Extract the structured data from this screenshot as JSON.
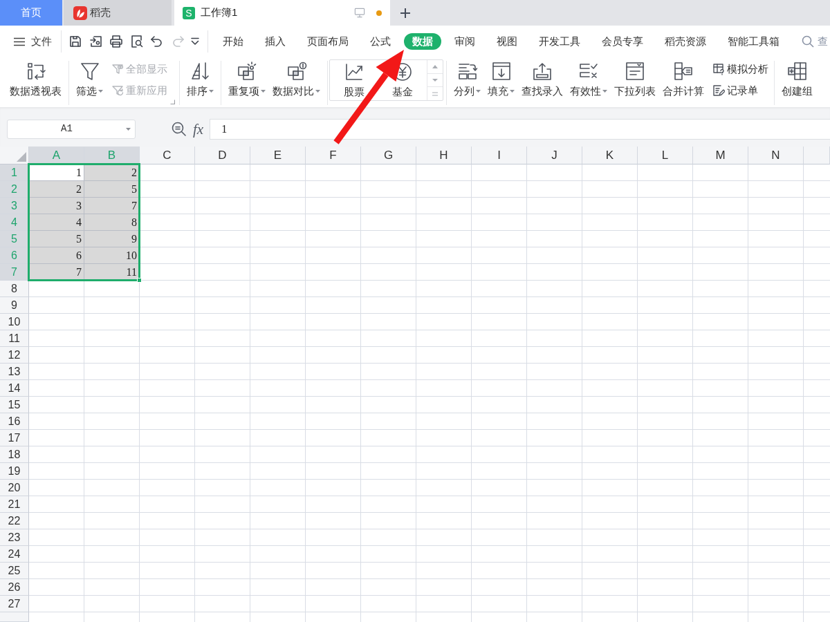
{
  "tabs": [
    {
      "kind": "home",
      "label": "首页",
      "selected": false
    },
    {
      "kind": "docer",
      "label": "稻壳",
      "selected": false
    },
    {
      "kind": "sheet",
      "badge": "S",
      "label": "工作簿1",
      "selected": true,
      "modified": true
    }
  ],
  "menu_bar": {
    "file_label": "文件",
    "quick_access": [
      {
        "kind": "save",
        "disabled": false
      },
      {
        "kind": "export",
        "disabled": false
      },
      {
        "kind": "print",
        "disabled": false
      },
      {
        "kind": "preview",
        "disabled": false
      },
      {
        "kind": "undo",
        "disabled": false
      },
      {
        "kind": "redo",
        "disabled": true
      },
      {
        "kind": "customize",
        "disabled": false
      }
    ],
    "tabs": [
      {
        "label": "开始",
        "selected": false
      },
      {
        "label": "插入",
        "selected": false
      },
      {
        "label": "页面布局",
        "selected": false
      },
      {
        "label": "公式",
        "selected": false
      },
      {
        "label": "数据",
        "selected": true
      },
      {
        "label": "审阅",
        "selected": false
      },
      {
        "label": "视图",
        "selected": false
      },
      {
        "label": "开发工具",
        "selected": false
      },
      {
        "label": "会员专享",
        "selected": false
      },
      {
        "label": "稻壳资源",
        "selected": false
      },
      {
        "label": "智能工具箱",
        "selected": false
      }
    ],
    "search_label": "查"
  },
  "ribbon": {
    "groups": [
      {
        "large": [
          {
            "kind": "pivot",
            "label": "数据透视表",
            "dropdown": false
          }
        ]
      },
      {
        "large": [
          {
            "kind": "filter",
            "label": "筛选",
            "dropdown": true
          }
        ],
        "small": [
          {
            "kind": "showall",
            "label": "全部显示",
            "disabled": true
          },
          {
            "kind": "reapply",
            "label": "重新应用",
            "disabled": true
          }
        ],
        "launcher": true
      },
      {
        "large": [
          {
            "kind": "sort",
            "label": "排序",
            "dropdown": true
          }
        ]
      },
      {
        "large": [
          {
            "kind": "duplicates",
            "label": "重复项",
            "dropdown": true
          },
          {
            "kind": "compare",
            "label": "数据对比",
            "dropdown": true
          }
        ]
      },
      {
        "gallery": [
          {
            "kind": "stock",
            "label": "股票"
          },
          {
            "kind": "fund",
            "label": "基金"
          }
        ]
      },
      {
        "large": [
          {
            "kind": "split",
            "label": "分列",
            "dropdown": true
          },
          {
            "kind": "fill",
            "label": "填充",
            "dropdown": true
          },
          {
            "kind": "lookup",
            "label": "查找录入",
            "dropdown": false
          },
          {
            "kind": "validity",
            "label": "有效性",
            "dropdown": true
          },
          {
            "kind": "dropdown",
            "label": "下拉列表",
            "dropdown": false
          },
          {
            "kind": "consolidate",
            "label": "合并计算",
            "dropdown": false
          }
        ],
        "small": [
          {
            "kind": "whatif",
            "label": "模拟分析",
            "disabled": false
          },
          {
            "kind": "form",
            "label": "记录单",
            "disabled": false
          }
        ]
      },
      {
        "large": [
          {
            "kind": "group",
            "label": "创建组",
            "dropdown": false
          }
        ]
      }
    ]
  },
  "formula_bar": {
    "name_box": "A1",
    "fx_label": "fx",
    "formula": "1"
  },
  "sheet": {
    "columns": [
      {
        "label": "A",
        "selected": true
      },
      {
        "label": "B",
        "selected": true
      },
      {
        "label": "C",
        "selected": false
      },
      {
        "label": "D",
        "selected": false
      },
      {
        "label": "E",
        "selected": false
      },
      {
        "label": "F",
        "selected": false
      },
      {
        "label": "G",
        "selected": false
      },
      {
        "label": "H",
        "selected": false
      },
      {
        "label": "I",
        "selected": false
      },
      {
        "label": "J",
        "selected": false
      },
      {
        "label": "K",
        "selected": false
      },
      {
        "label": "L",
        "selected": false
      },
      {
        "label": "M",
        "selected": false
      },
      {
        "label": "N",
        "selected": false
      },
      {
        "selected": false
      }
    ],
    "rows": [
      {
        "label": "1",
        "selected": true,
        "cells": [
          {
            "value": "1",
            "selected": true,
            "active": true
          },
          {
            "value": "2",
            "selected": true,
            "active": false
          }
        ]
      },
      {
        "label": "2",
        "selected": true,
        "cells": [
          {
            "value": "2",
            "selected": true,
            "active": false
          },
          {
            "value": "5",
            "selected": true,
            "active": false
          }
        ]
      },
      {
        "label": "3",
        "selected": true,
        "cells": [
          {
            "value": "3",
            "selected": true,
            "active": false
          },
          {
            "value": "7",
            "selected": true,
            "active": false
          }
        ]
      },
      {
        "label": "4",
        "selected": true,
        "cells": [
          {
            "value": "4",
            "selected": true,
            "active": false
          },
          {
            "value": "8",
            "selected": true,
            "active": false
          }
        ]
      },
      {
        "label": "5",
        "selected": true,
        "cells": [
          {
            "value": "5",
            "selected": true,
            "active": false
          },
          {
            "value": "9",
            "selected": true,
            "active": false
          }
        ]
      },
      {
        "label": "6",
        "selected": true,
        "cells": [
          {
            "value": "6",
            "selected": true,
            "active": false
          },
          {
            "value": "10",
            "selected": true,
            "active": false
          }
        ]
      },
      {
        "label": "7",
        "selected": true,
        "cells": [
          {
            "value": "7",
            "selected": true,
            "active": false
          },
          {
            "value": "11",
            "selected": true,
            "active": false
          }
        ]
      },
      {
        "label": "8",
        "selected": false
      },
      {
        "label": "9",
        "selected": false
      },
      {
        "label": "10",
        "selected": false
      },
      {
        "label": "11",
        "selected": false
      },
      {
        "label": "12",
        "selected": false
      },
      {
        "label": "13",
        "selected": false
      },
      {
        "label": "14",
        "selected": false
      },
      {
        "label": "15",
        "selected": false
      },
      {
        "label": "16",
        "selected": false
      },
      {
        "label": "17",
        "selected": false
      },
      {
        "label": "18",
        "selected": false
      },
      {
        "label": "19",
        "selected": false
      },
      {
        "label": "20",
        "selected": false
      },
      {
        "label": "21",
        "selected": false
      },
      {
        "label": "22",
        "selected": false
      },
      {
        "label": "23",
        "selected": false
      },
      {
        "label": "24",
        "selected": false
      },
      {
        "label": "25",
        "selected": false
      },
      {
        "label": "26",
        "selected": false
      },
      {
        "label": "27",
        "selected": false
      },
      {
        "selected": false
      }
    ]
  },
  "annotations": [
    {
      "kind": "arrow"
    }
  ]
}
